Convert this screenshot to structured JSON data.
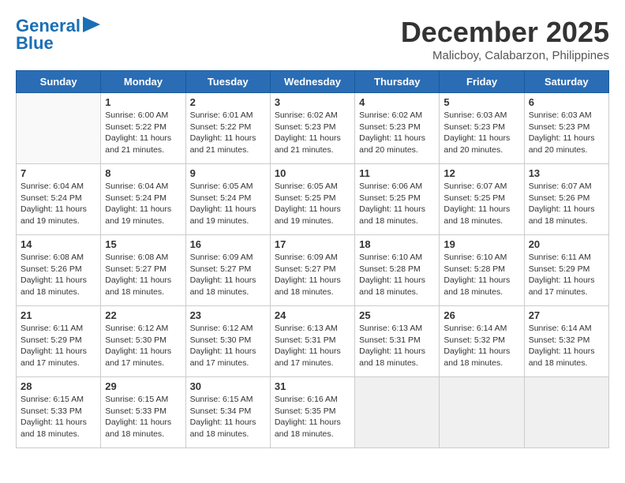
{
  "header": {
    "logo_line1": "General",
    "logo_line2": "Blue",
    "month": "December 2025",
    "location": "Malicboy, Calabarzon, Philippines"
  },
  "days": [
    "Sunday",
    "Monday",
    "Tuesday",
    "Wednesday",
    "Thursday",
    "Friday",
    "Saturday"
  ],
  "weeks": [
    [
      {
        "day": "",
        "content": ""
      },
      {
        "day": "1",
        "content": "Sunrise: 6:00 AM\nSunset: 5:22 PM\nDaylight: 11 hours and 21 minutes."
      },
      {
        "day": "2",
        "content": "Sunrise: 6:01 AM\nSunset: 5:22 PM\nDaylight: 11 hours and 21 minutes."
      },
      {
        "day": "3",
        "content": "Sunrise: 6:02 AM\nSunset: 5:23 PM\nDaylight: 11 hours and 21 minutes."
      },
      {
        "day": "4",
        "content": "Sunrise: 6:02 AM\nSunset: 5:23 PM\nDaylight: 11 hours and 20 minutes."
      },
      {
        "day": "5",
        "content": "Sunrise: 6:03 AM\nSunset: 5:23 PM\nDaylight: 11 hours and 20 minutes."
      },
      {
        "day": "6",
        "content": "Sunrise: 6:03 AM\nSunset: 5:23 PM\nDaylight: 11 hours and 20 minutes."
      }
    ],
    [
      {
        "day": "7",
        "content": "Sunrise: 6:04 AM\nSunset: 5:24 PM\nDaylight: 11 hours and 19 minutes."
      },
      {
        "day": "8",
        "content": "Sunrise: 6:04 AM\nSunset: 5:24 PM\nDaylight: 11 hours and 19 minutes."
      },
      {
        "day": "9",
        "content": "Sunrise: 6:05 AM\nSunset: 5:24 PM\nDaylight: 11 hours and 19 minutes."
      },
      {
        "day": "10",
        "content": "Sunrise: 6:05 AM\nSunset: 5:25 PM\nDaylight: 11 hours and 19 minutes."
      },
      {
        "day": "11",
        "content": "Sunrise: 6:06 AM\nSunset: 5:25 PM\nDaylight: 11 hours and 18 minutes."
      },
      {
        "day": "12",
        "content": "Sunrise: 6:07 AM\nSunset: 5:25 PM\nDaylight: 11 hours and 18 minutes."
      },
      {
        "day": "13",
        "content": "Sunrise: 6:07 AM\nSunset: 5:26 PM\nDaylight: 11 hours and 18 minutes."
      }
    ],
    [
      {
        "day": "14",
        "content": "Sunrise: 6:08 AM\nSunset: 5:26 PM\nDaylight: 11 hours and 18 minutes."
      },
      {
        "day": "15",
        "content": "Sunrise: 6:08 AM\nSunset: 5:27 PM\nDaylight: 11 hours and 18 minutes."
      },
      {
        "day": "16",
        "content": "Sunrise: 6:09 AM\nSunset: 5:27 PM\nDaylight: 11 hours and 18 minutes."
      },
      {
        "day": "17",
        "content": "Sunrise: 6:09 AM\nSunset: 5:27 PM\nDaylight: 11 hours and 18 minutes."
      },
      {
        "day": "18",
        "content": "Sunrise: 6:10 AM\nSunset: 5:28 PM\nDaylight: 11 hours and 18 minutes."
      },
      {
        "day": "19",
        "content": "Sunrise: 6:10 AM\nSunset: 5:28 PM\nDaylight: 11 hours and 18 minutes."
      },
      {
        "day": "20",
        "content": "Sunrise: 6:11 AM\nSunset: 5:29 PM\nDaylight: 11 hours and 17 minutes."
      }
    ],
    [
      {
        "day": "21",
        "content": "Sunrise: 6:11 AM\nSunset: 5:29 PM\nDaylight: 11 hours and 17 minutes."
      },
      {
        "day": "22",
        "content": "Sunrise: 6:12 AM\nSunset: 5:30 PM\nDaylight: 11 hours and 17 minutes."
      },
      {
        "day": "23",
        "content": "Sunrise: 6:12 AM\nSunset: 5:30 PM\nDaylight: 11 hours and 17 minutes."
      },
      {
        "day": "24",
        "content": "Sunrise: 6:13 AM\nSunset: 5:31 PM\nDaylight: 11 hours and 17 minutes."
      },
      {
        "day": "25",
        "content": "Sunrise: 6:13 AM\nSunset: 5:31 PM\nDaylight: 11 hours and 18 minutes."
      },
      {
        "day": "26",
        "content": "Sunrise: 6:14 AM\nSunset: 5:32 PM\nDaylight: 11 hours and 18 minutes."
      },
      {
        "day": "27",
        "content": "Sunrise: 6:14 AM\nSunset: 5:32 PM\nDaylight: 11 hours and 18 minutes."
      }
    ],
    [
      {
        "day": "28",
        "content": "Sunrise: 6:15 AM\nSunset: 5:33 PM\nDaylight: 11 hours and 18 minutes."
      },
      {
        "day": "29",
        "content": "Sunrise: 6:15 AM\nSunset: 5:33 PM\nDaylight: 11 hours and 18 minutes."
      },
      {
        "day": "30",
        "content": "Sunrise: 6:15 AM\nSunset: 5:34 PM\nDaylight: 11 hours and 18 minutes."
      },
      {
        "day": "31",
        "content": "Sunrise: 6:16 AM\nSunset: 5:35 PM\nDaylight: 11 hours and 18 minutes."
      },
      {
        "day": "",
        "content": ""
      },
      {
        "day": "",
        "content": ""
      },
      {
        "day": "",
        "content": ""
      }
    ]
  ]
}
